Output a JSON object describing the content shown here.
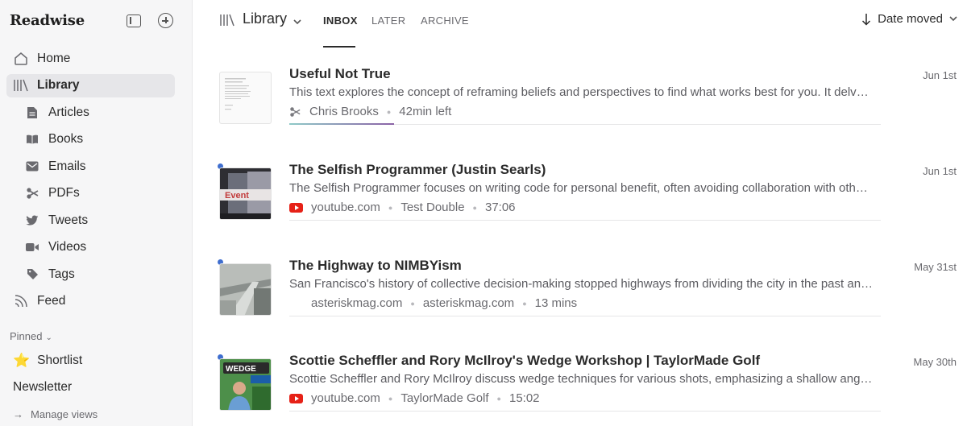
{
  "sidebar": {
    "brand": "Readwise",
    "nav": [
      {
        "label": "Home",
        "icon": "home-icon",
        "level": "top",
        "active": false
      },
      {
        "label": "Library",
        "icon": "library-icon",
        "level": "top",
        "active": true
      },
      {
        "label": "Articles",
        "icon": "article-icon",
        "level": "sub",
        "active": false
      },
      {
        "label": "Books",
        "icon": "book-icon",
        "level": "sub",
        "active": false
      },
      {
        "label": "Emails",
        "icon": "email-icon",
        "level": "sub",
        "active": false
      },
      {
        "label": "PDFs",
        "icon": "pdf-icon",
        "level": "sub",
        "active": false
      },
      {
        "label": "Tweets",
        "icon": "tweet-icon",
        "level": "sub",
        "active": false
      },
      {
        "label": "Videos",
        "icon": "video-icon",
        "level": "sub",
        "active": false
      },
      {
        "label": "Tags",
        "icon": "tag-icon",
        "level": "sub",
        "active": false
      },
      {
        "label": "Feed",
        "icon": "feed-icon",
        "level": "top",
        "active": false
      }
    ],
    "pinned_label": "Pinned",
    "pinned": [
      {
        "label": "Shortlist",
        "icon": "star-icon"
      },
      {
        "label": "Newsletter",
        "icon": ""
      }
    ],
    "manage_views": "Manage views"
  },
  "header": {
    "title": "Library",
    "tabs": [
      "INBOX",
      "LATER",
      "ARCHIVE"
    ],
    "active_tab": "INBOX",
    "sort_label": "Date moved"
  },
  "documents": [
    {
      "title": "Useful Not True",
      "summary": "This text explores the concept of reframing beliefs and perspectives to find what works best for you. It delves into the idea that usefulness matters more than truth.",
      "meta": [
        "Chris Brooks",
        "42min left"
      ],
      "meta_icon": "pdf-icon",
      "date": "Jun 1st",
      "unread": false,
      "progress": 0.18
    },
    {
      "title": "The Selfish Programmer (Justin Searls)",
      "summary": "The Selfish Programmer focuses on writing code for personal benefit, often avoiding collaboration with others and embracing the joy of building for oneself.",
      "meta": [
        "youtube.com",
        "Test Double",
        "37:06"
      ],
      "meta_icon": "youtube-icon",
      "date": "Jun 1st",
      "unread": true
    },
    {
      "title": "The Highway to NIMBYism",
      "summary": "San Francisco's history of collective decision-making stopped highways from dividing the city in the past and shaped its present.",
      "meta": [
        "asteriskmag.com",
        "asteriskmag.com",
        "13 mins"
      ],
      "meta_icon": "",
      "date": "May 31st",
      "unread": true
    },
    {
      "title": "Scottie Scheffler and Rory McIlroy's Wedge Workshop | TaylorMade Golf",
      "summary": "Scottie Scheffler and Rory McIlroy discuss wedge techniques for various shots, emphasizing a shallow angle of attack and control.",
      "meta": [
        "youtube.com",
        "TaylorMade Golf",
        "15:02"
      ],
      "meta_icon": "youtube-icon",
      "date": "May 30th",
      "unread": true
    }
  ]
}
